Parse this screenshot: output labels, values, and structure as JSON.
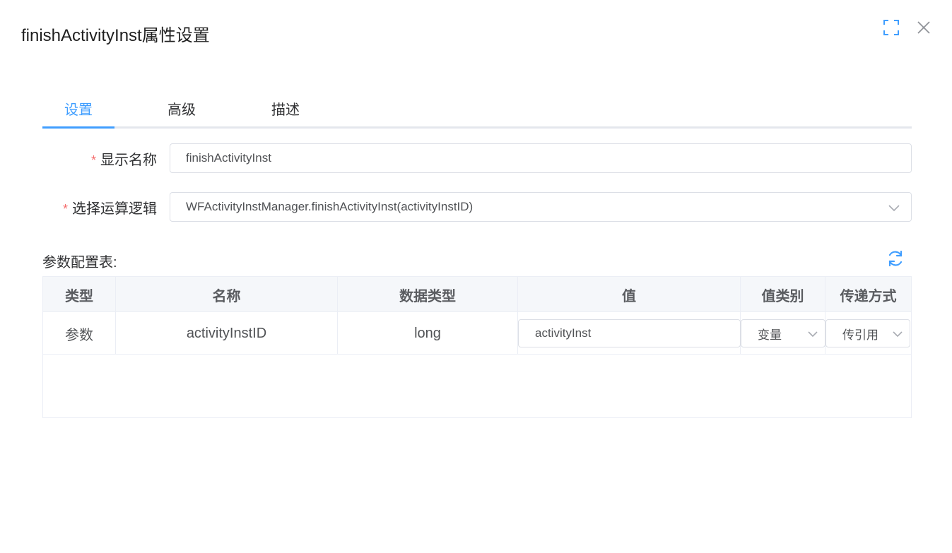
{
  "dialog": {
    "title": "finishActivityInst属性设置"
  },
  "tabs": [
    {
      "label": "设置",
      "active": true
    },
    {
      "label": "高级",
      "active": false
    },
    {
      "label": "描述",
      "active": false
    }
  ],
  "form": {
    "required_mark": "*",
    "display_name": {
      "label": "显示名称",
      "value": "finishActivityInst"
    },
    "logic": {
      "label": "选择运算逻辑",
      "value": "WFActivityInstManager.finishActivityInst(activityInstID)"
    }
  },
  "params": {
    "section_label": "参数配置表:",
    "columns": [
      "类型",
      "名称",
      "数据类型",
      "值",
      "值类别",
      "传递方式"
    ],
    "rows": [
      {
        "type": "参数",
        "name": "activityInstID",
        "data_type": "long",
        "value": "activityInst",
        "value_category": "变量",
        "pass_mode": "传引用"
      }
    ]
  },
  "colors": {
    "accent": "#409eff",
    "required": "#f56c6c",
    "border": "#dcdfe6"
  },
  "icons": {
    "fullscreen": "fullscreen-icon",
    "close": "close-icon",
    "refresh": "refresh-icon",
    "dropdown": "chevron-down-icon"
  }
}
